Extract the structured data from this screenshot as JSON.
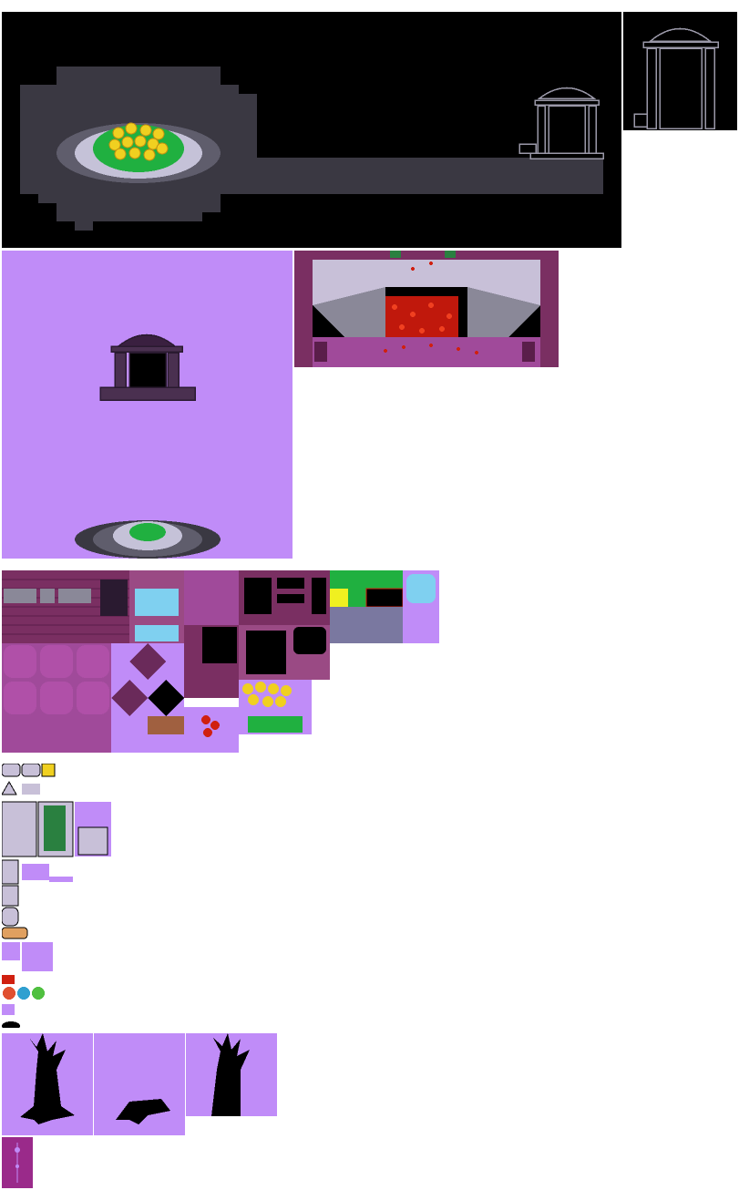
{
  "sheet": {
    "kind": "sprite-sheet",
    "background": "#ffffff",
    "palette": {
      "void": "#000000",
      "cave_floor": "#3a3842",
      "purple_floor": "#c08cf8",
      "brick": "#7a2f62",
      "brick_light": "#9a4a84",
      "flower_yellow": "#f0d020",
      "flower_red": "#d02010",
      "grass": "#20b040",
      "lavender": "#c8c0d8",
      "water": "#7fd0f0"
    }
  },
  "maps": [
    {
      "name": "flower-cave-room",
      "content": [
        "golden-flowers",
        "grass-patch",
        "ruins-doorway"
      ]
    },
    {
      "name": "ruins-doorway-closeup",
      "content": [
        "ruins-doorway"
      ]
    },
    {
      "name": "purple-ruins-room",
      "content": [
        "ruins-doorway",
        "grass-patch"
      ]
    },
    {
      "name": "red-leaves-room",
      "content": [
        "red-leaf-pile",
        "stairs",
        "vines"
      ]
    }
  ],
  "tiles": {
    "brick_walls": 3,
    "floor_tiles": 12,
    "misc_tiles": 9
  },
  "props": [
    "ruins-pillar",
    "vine-pillar",
    "broken-pillar",
    "cobweb",
    "spider-web",
    "mushrooms",
    "table",
    "rock",
    "bench"
  ],
  "trees": [
    "dead-tree-full",
    "dead-tree-stump",
    "dead-tree-trunk"
  ],
  "door_sprite": "ruins-door-purple"
}
